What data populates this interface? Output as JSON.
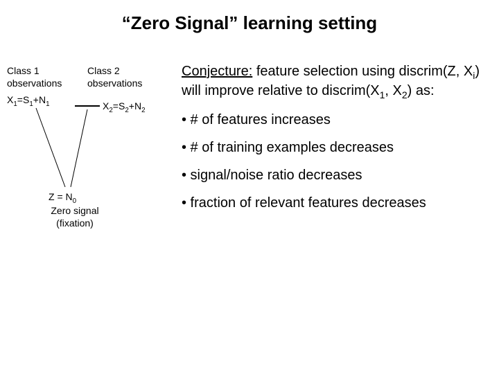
{
  "title": "“Zero Signal” learning setting",
  "diagram": {
    "class1_line1": "Class 1",
    "class1_line2": "observations",
    "class2_line1": "Class 2",
    "class2_line2": "observations",
    "x1_eq_pre": "X",
    "x1_eq_post": "=S",
    "x1_eq_post2": "+N",
    "x2_eq_pre": "X",
    "x2_eq_post": "=S",
    "x2_eq_post2": "+N",
    "z_eq_pre": "Z = N",
    "z_label_line1": "Zero signal",
    "z_label_line2": "(fixation)"
  },
  "conjecture": {
    "label": "Conjecture:",
    "body_part1": "  feature selection using discrim(Z, X",
    "body_part2": ") will improve relative to discrim(X",
    "body_part3": ", X",
    "body_part4": ") as:"
  },
  "bullets": {
    "b1": "• # of features increases",
    "b2": "• # of training examples decreases",
    "b3": "• signal/noise ratio decreases",
    "b4": "• fraction of relevant features decreases"
  }
}
